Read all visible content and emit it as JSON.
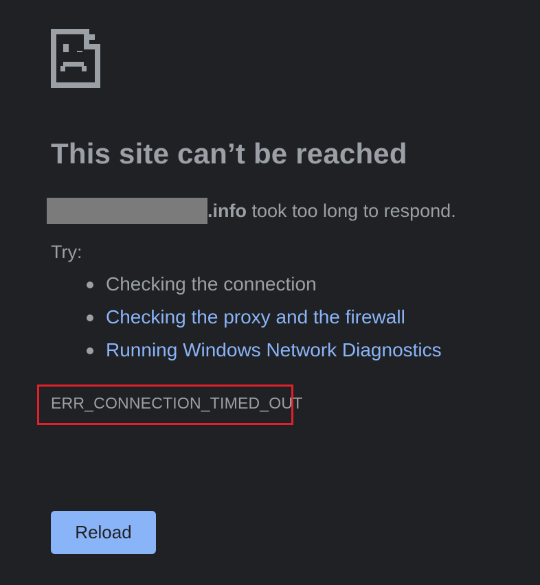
{
  "icon": {
    "name": "sad-page-icon",
    "color": "#9aa0a6"
  },
  "title": "This site can’t be reached",
  "subtitle": {
    "domain_suffix": ".info",
    "message": " took too long to respond."
  },
  "try_label": "Try:",
  "suggestions": [
    {
      "label": "Checking the connection",
      "is_link": false
    },
    {
      "label": "Checking the proxy and the firewall",
      "is_link": true
    },
    {
      "label": "Running Windows Network Diagnostics",
      "is_link": true
    }
  ],
  "error_code": "ERR_CONNECTION_TIMED_OUT",
  "reload_button": {
    "label": "Reload"
  },
  "colors": {
    "background": "#202124",
    "text": "#9aa0a6",
    "link": "#8ab4f8",
    "button": "#8ab4f8",
    "highlight_border": "#e0202a"
  }
}
